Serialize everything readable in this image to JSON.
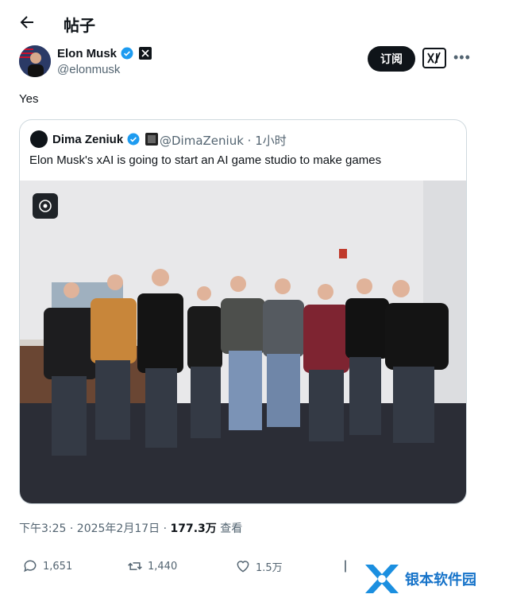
{
  "header": {
    "title": "帖子"
  },
  "author": {
    "name": "Elon Musk",
    "handle": "@elonmusk"
  },
  "buttons": {
    "subscribe": "订阅",
    "grok": "x̸"
  },
  "tweet": {
    "text": "Yes"
  },
  "quote": {
    "name": "Dima Zeniuk",
    "handle_time": "@DimaZeniuk · 1小时",
    "text": "Elon Musk's xAI is going to start an AI game studio to make games"
  },
  "meta": {
    "time_date": "下午3:25 · 2025年2月17日 · ",
    "views": "177.3万",
    "views_label": " 查看"
  },
  "stats": {
    "replies": "1,651",
    "reposts": "1,440",
    "likes": "1.5万"
  },
  "watermark": {
    "text": "银本软件园"
  },
  "colors": {
    "link_blue": "#1d9bf0",
    "text": "#0f1419",
    "muted": "#536471",
    "border": "#cfd9de"
  },
  "icons": [
    "back-arrow-icon",
    "verified-icon",
    "x-affiliate-icon",
    "grok-icon",
    "more-icon",
    "reply-icon",
    "repost-icon",
    "like-icon"
  ]
}
